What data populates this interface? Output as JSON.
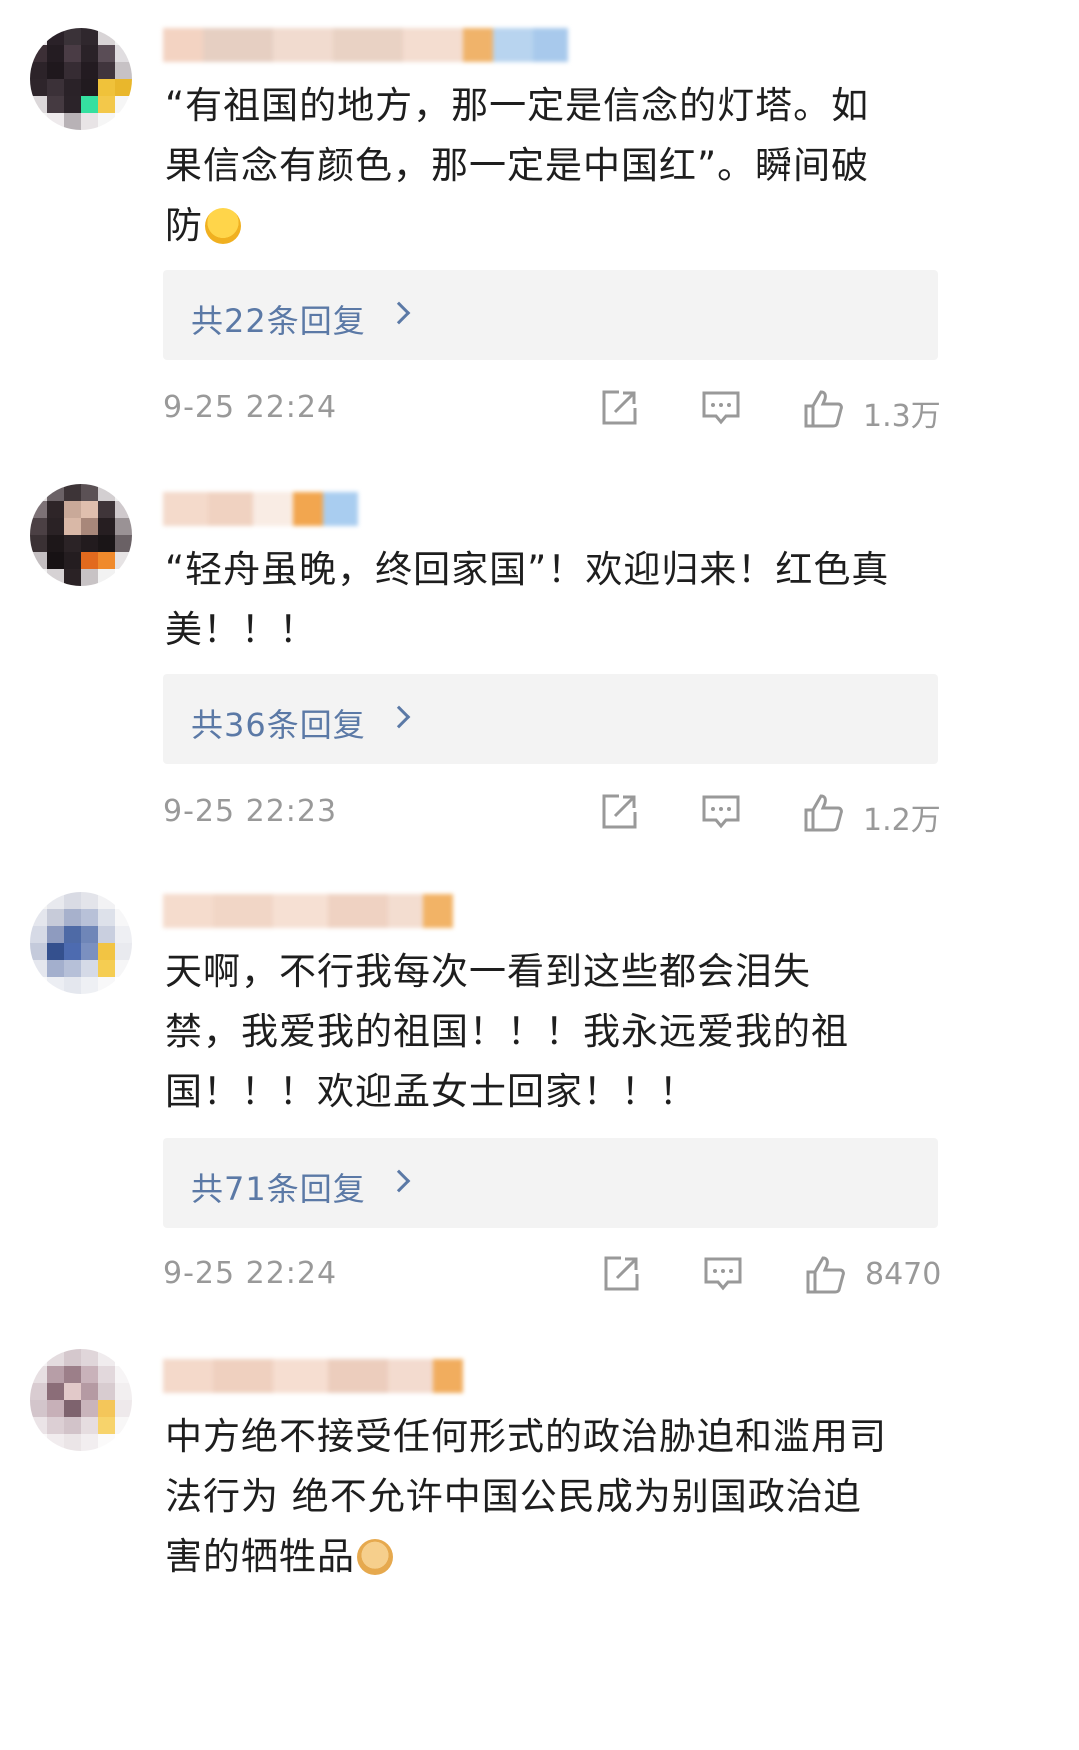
{
  "colors": {
    "reply_link": "#5b79a6",
    "meta_text": "#999999",
    "reply_bg": "#f3f3f3"
  },
  "comments": [
    {
      "text": "“有祖国的地方，那一定是信念的灯塔。如\n果信念有颜色，那一定是中国红”。瞬间破\n防",
      "emoji": "crying-face-icon",
      "reply_label": "共22条回复",
      "time": "9-25 22:24",
      "likes": "1.3万"
    },
    {
      "text": "“轻舟虽晚，终回家国”！欢迎归来！红色真\n美！！！",
      "reply_label": "共36条回复",
      "time": "9-25 22:23",
      "likes": "1.2万"
    },
    {
      "text": "天啊，不行我每次一看到这些都会泪失\n禁，我爱我的祖国！！！我永远爱我的祖\n国！！！欢迎孟女士回家！！！",
      "reply_label": "共71条回复",
      "time": "9-25 22:24",
      "likes": "8470"
    },
    {
      "text": "中方绝不接受任何形式的政治胁迫和滥用司\n法行为 绝不允许中国公民成为别国政治迫\n害的牺牲品",
      "emoji": "fist-icon"
    }
  ]
}
